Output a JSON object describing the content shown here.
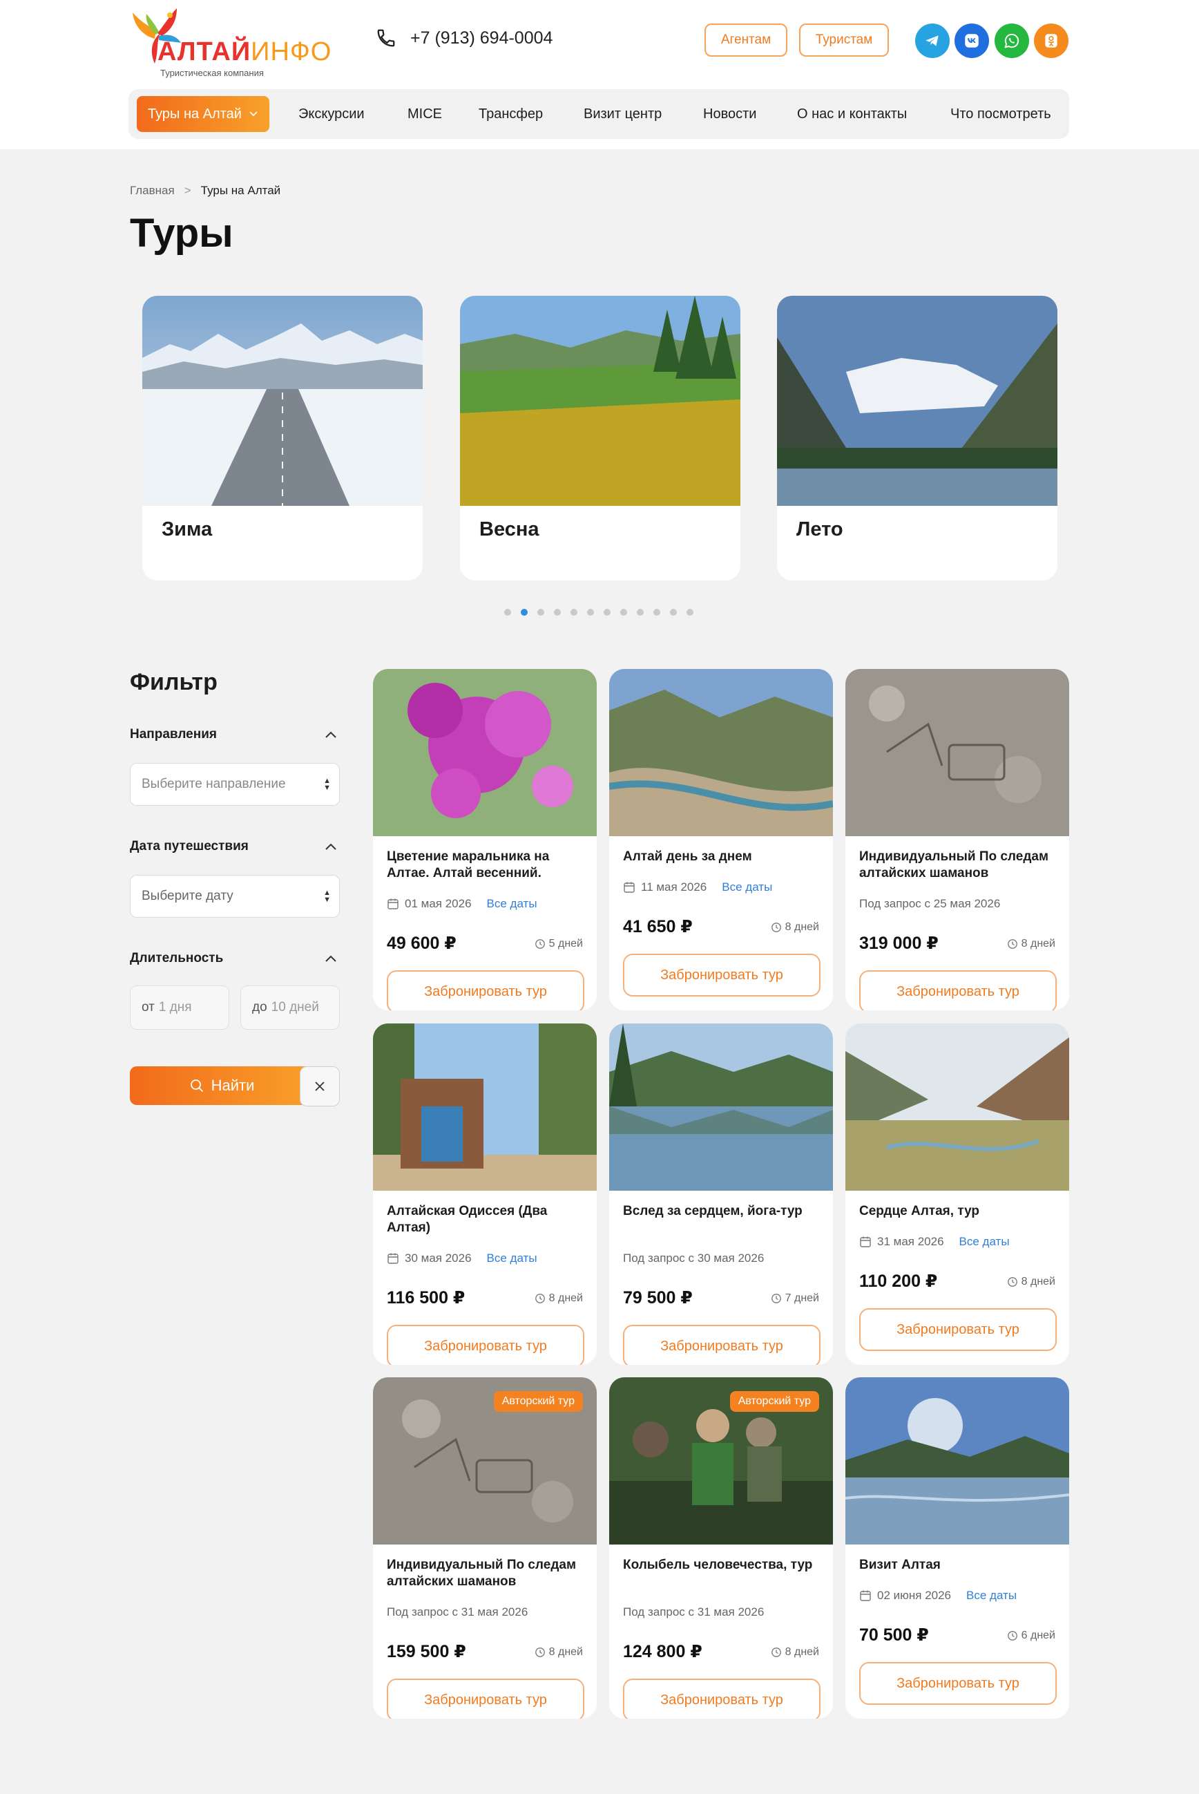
{
  "brand": {
    "name_part1": "АЛТАЙ",
    "name_part2": "ИНФО",
    "tagline": "Туристическая компания",
    "colors": {
      "accent": "#f58220",
      "accent_red": "#e8322d",
      "link_blue": "#2f7fd8"
    }
  },
  "header": {
    "phone": "+7 (913) 694-0004",
    "agents_label": "Агентам",
    "tourists_label": "Туристам",
    "social": [
      "telegram-icon",
      "vk-icon",
      "whatsapp-icon",
      "odnoklassniki-icon"
    ]
  },
  "nav": {
    "active": "Туры на Алтай",
    "items": [
      "Экскурсии",
      "MICE",
      "Трансфер",
      "Визит центр",
      "Новости",
      "О нас и контакты",
      "Что посмотреть"
    ]
  },
  "breadcrumb": {
    "home": "Главная",
    "separator": ">",
    "current": "Туры на Алтай"
  },
  "page_title": "Туры",
  "seasons": [
    "Зима",
    "Весна",
    "Лето"
  ],
  "slider": {
    "dot_count": 12,
    "active_dot": 2
  },
  "filter": {
    "title": "Фильтр",
    "direction_label": "Направления",
    "direction_placeholder": "Выберите направление",
    "date_label": "Дата путешествия",
    "date_placeholder": "Выберите дату",
    "duration_label": "Длительность",
    "from_prefix": "от",
    "from_placeholder": "1 дня",
    "to_prefix": "до",
    "to_placeholder": "10 дней",
    "find_label": "Найти"
  },
  "tours": [
    {
      "title": "Цветение маральника на Алтае. Алтай весенний.",
      "date": "01 мая 2026",
      "all_dates": "Все даты",
      "price": "49 600 ₽",
      "days": "5 дней",
      "book": "Забронировать тур",
      "badge": ""
    },
    {
      "title": "Алтай день за днем",
      "date": "11 мая 2026",
      "all_dates": "Все даты",
      "price": "41 650 ₽",
      "days": "8 дней",
      "book": "Забронировать тур",
      "badge": ""
    },
    {
      "title": "Индивидуальный По следам алтайских шаманов",
      "date": "Под запрос с 25 мая 2026",
      "all_dates": "",
      "price": "319 000 ₽",
      "days": "8 дней",
      "book": "Забронировать тур",
      "badge": ""
    },
    {
      "title": "Алтайская Одиссея (Два Алтая)",
      "date": "30 мая 2026",
      "all_dates": "Все даты",
      "price": "116 500 ₽",
      "days": "8 дней",
      "book": "Забронировать тур",
      "badge": ""
    },
    {
      "title": "Вслед за сердцем, йога-тур",
      "date": "Под запрос с 30 мая 2026",
      "all_dates": "",
      "price": "79 500 ₽",
      "days": "7 дней",
      "book": "Забронировать тур",
      "badge": ""
    },
    {
      "title": "Сердце Алтая, тур",
      "date": "31 мая 2026",
      "all_dates": "Все даты",
      "price": "110 200 ₽",
      "days": "8 дней",
      "book": "Забронировать тур",
      "badge": ""
    },
    {
      "title": "Индивидуальный По следам алтайских шаманов",
      "date": "Под запрос с 31 мая 2026",
      "all_dates": "",
      "price": "159 500 ₽",
      "days": "8 дней",
      "book": "Забронировать тур",
      "badge": "Авторский тур"
    },
    {
      "title": "Колыбель человечества, тур",
      "date": "Под запрос с 31 мая 2026",
      "all_dates": "",
      "price": "124 800 ₽",
      "days": "8 дней",
      "book": "Забронировать тур",
      "badge": "Авторский тур"
    },
    {
      "title": "Визит Алтая",
      "date": "02 июня 2026",
      "all_dates": "Все даты",
      "price": "70 500 ₽",
      "days": "6 дней",
      "book": "Забронировать тур",
      "badge": ""
    }
  ]
}
